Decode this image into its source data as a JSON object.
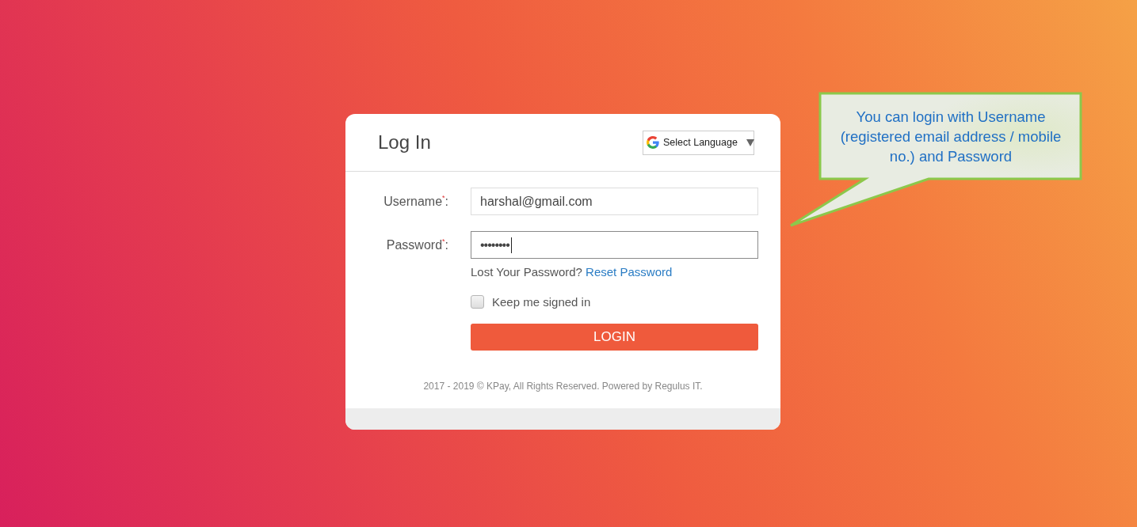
{
  "header": {
    "title": "Log In",
    "language_selector": {
      "label": "Select Language"
    }
  },
  "form": {
    "fields": [
      {
        "label": "Username$^{*}$:",
        "value": "harshal@gmail.com",
        "focused": false
      },
      {
        "label": "Password$^{*}$:",
        "value": "••••••••",
        "focused": true
      }
    ],
    "lost_password": {
      "text": "Lost Your Password?",
      "link": "Reset Password"
    },
    "keep_signed_in": {
      "label": "Keep me signed in",
      "checked": false
    },
    "submit_button": "LOGIN"
  },
  "footer": "2017 - 2019 © KPay, All Rights Reserved. Powered by Regulus IT.",
  "callout": {
    "text": "You can login with Username (registered email address / mobile no.) and Password"
  }
}
